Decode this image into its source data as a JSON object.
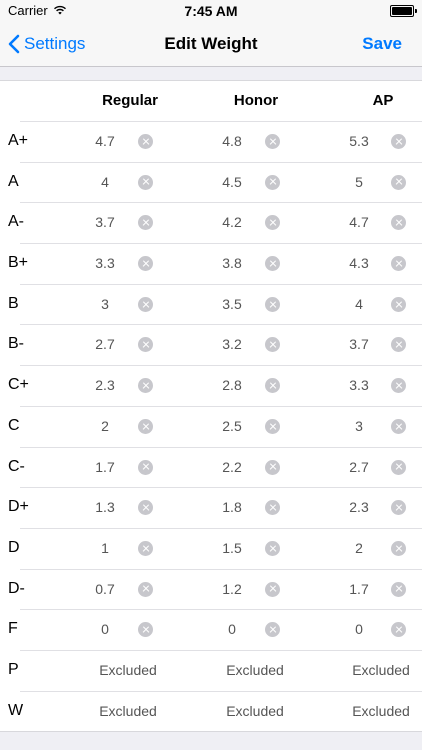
{
  "status_bar": {
    "carrier": "Carrier",
    "time": "7:45 AM"
  },
  "nav": {
    "back_label": "Settings",
    "title": "Edit Weight",
    "save_label": "Save"
  },
  "columns": [
    "Regular",
    "Honor",
    "AP"
  ],
  "rows": [
    {
      "grade": "A+",
      "values": [
        "4.7",
        "4.8",
        "5.3"
      ]
    },
    {
      "grade": "A",
      "values": [
        "4",
        "4.5",
        "5"
      ]
    },
    {
      "grade": "A-",
      "values": [
        "3.7",
        "4.2",
        "4.7"
      ]
    },
    {
      "grade": "B+",
      "values": [
        "3.3",
        "3.8",
        "4.3"
      ]
    },
    {
      "grade": "B",
      "values": [
        "3",
        "3.5",
        "4"
      ]
    },
    {
      "grade": "B-",
      "values": [
        "2.7",
        "3.2",
        "3.7"
      ]
    },
    {
      "grade": "C+",
      "values": [
        "2.3",
        "2.8",
        "3.3"
      ]
    },
    {
      "grade": "C",
      "values": [
        "2",
        "2.5",
        "3"
      ]
    },
    {
      "grade": "C-",
      "values": [
        "1.7",
        "2.2",
        "2.7"
      ]
    },
    {
      "grade": "D+",
      "values": [
        "1.3",
        "1.8",
        "2.3"
      ]
    },
    {
      "grade": "D",
      "values": [
        "1",
        "1.5",
        "2"
      ]
    },
    {
      "grade": "D-",
      "values": [
        "0.7",
        "1.2",
        "1.7"
      ]
    },
    {
      "grade": "F",
      "values": [
        "0",
        "0",
        "0"
      ]
    }
  ],
  "excluded_rows": [
    {
      "grade": "P",
      "values": [
        "Excluded",
        "Excluded",
        "Excluded"
      ]
    },
    {
      "grade": "W",
      "values": [
        "Excluded",
        "Excluded",
        "Excluded"
      ]
    }
  ],
  "colors": {
    "accent": "#007aff",
    "clear_button": "#c7c7cc"
  },
  "icons": {
    "back": "chevron-left-icon",
    "clear": "clear-circle-icon",
    "wifi": "wifi-icon",
    "battery": "battery-icon"
  }
}
